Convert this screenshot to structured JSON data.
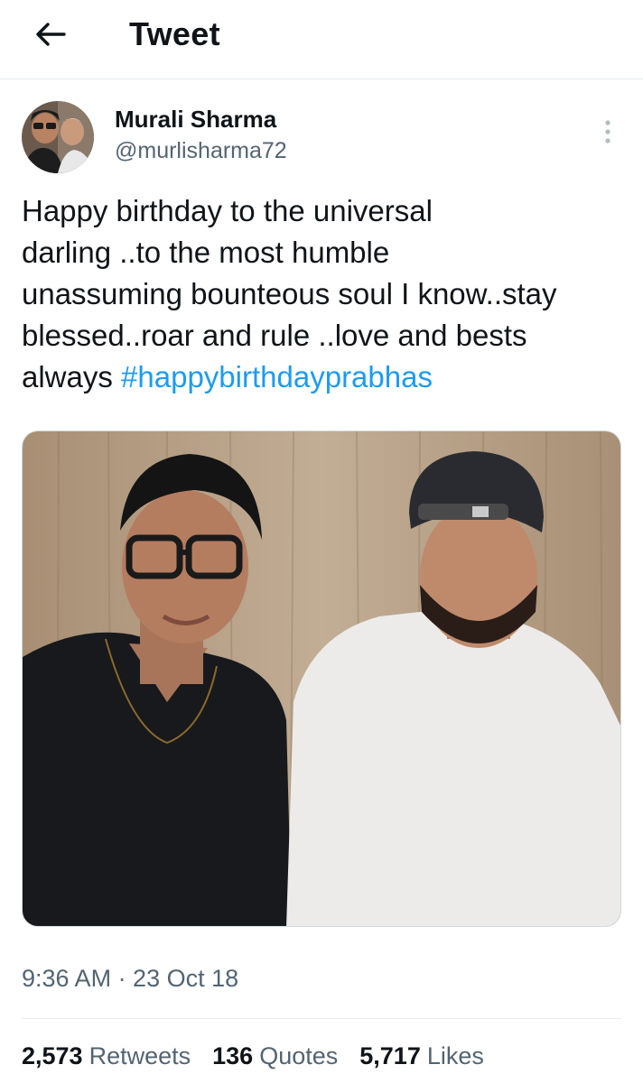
{
  "header": {
    "title": "Tweet"
  },
  "author": {
    "display_name": "Murali Sharma",
    "handle": "@murlisharma72"
  },
  "tweet": {
    "text_lines": [
      "Happy birthday to the universal",
      "darling ..to the most humble",
      "unassuming bounteous soul I know..stay",
      "blessed..roar and rule ..love and bests"
    ],
    "last_line_prefix": "always ",
    "hashtag": "#happybirthdayprabhas",
    "timestamp": "9:36 AM · 23 Oct 18"
  },
  "stats": [
    {
      "count": "2,573",
      "label": "Retweets"
    },
    {
      "count": "136",
      "label": "Quotes"
    },
    {
      "count": "5,717",
      "label": "Likes"
    }
  ],
  "colors": {
    "link": "#1d9bf0",
    "secondary_text": "#536471",
    "primary_text": "#0f1419",
    "divider": "#e6ecf0"
  },
  "icons": {
    "back": "arrow-left-icon",
    "more": "more-vertical-icon"
  }
}
